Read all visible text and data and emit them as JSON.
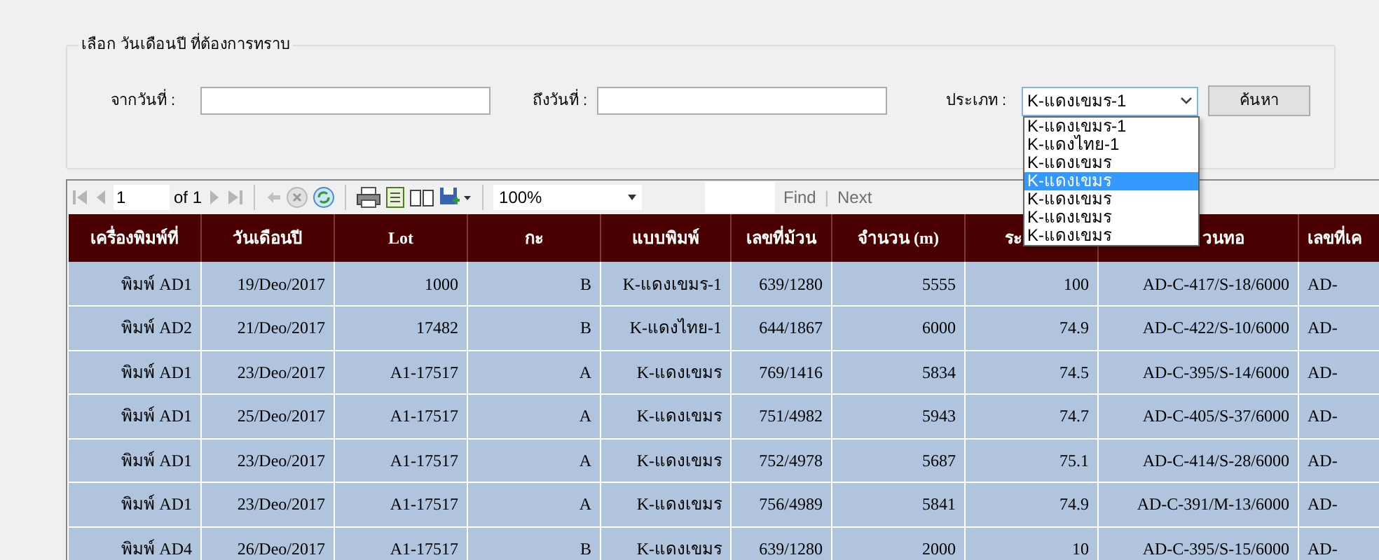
{
  "filter_group": {
    "title": "เลือก วันเดือนปี ที่ต้องการทราบ",
    "from_label": "จากวันที่ :",
    "to_label": "ถึงวันที่ :",
    "type_label": "ประเภท :",
    "type_value": "K-แดงเขมร-1",
    "expanded": true,
    "search_button": "ค้นหา",
    "options": [
      {
        "label": "K-แดงเขมร-1",
        "selected": false
      },
      {
        "label": "K-แดงไทย-1",
        "selected": false
      },
      {
        "label": "K-แดงเขมร",
        "selected": false
      },
      {
        "label": "K-แดงเขมร",
        "selected": true
      },
      {
        "label": "K-แดงเขมร",
        "selected": false
      },
      {
        "label": "K-แดงเขมร",
        "selected": false
      },
      {
        "label": "K-แดงเขมร",
        "selected": false
      }
    ]
  },
  "toolbar": {
    "page": "1",
    "of_pages": "of 1",
    "zoom": "100%",
    "find": "Find",
    "separator": "|",
    "next": "Next"
  },
  "table": {
    "columns": [
      {
        "label": "เครื่องพิมพ์ที่"
      },
      {
        "label": "วันเดือนปี"
      },
      {
        "label": "Lot"
      },
      {
        "label": "กะ"
      },
      {
        "label": "แบบพิมพ์"
      },
      {
        "label": "เลขที่ม้วน"
      },
      {
        "label": "จำนวน (m)"
      },
      {
        "label": "ระ"
      },
      {
        "label": "วนทอ"
      },
      {
        "label": "เลขที่เค"
      }
    ],
    "rows": [
      [
        "พิมพ์ AD1",
        "19/Deo/2017",
        "1000",
        "B",
        "K-แดงเขมร-1",
        "639/1280",
        "5555",
        "100",
        "AD-C-417/S-18/6000",
        "AD-"
      ],
      [
        "พิมพ์ AD2",
        "21/Deo/2017",
        "17482",
        "B",
        "K-แดงไทย-1",
        "644/1867",
        "6000",
        "74.9",
        "AD-C-422/S-10/6000",
        "AD-"
      ],
      [
        "พิมพ์ AD1",
        "23/Deo/2017",
        "A1-17517",
        "A",
        "K-แดงเขมร",
        "769/1416",
        "5834",
        "74.5",
        "AD-C-395/S-14/6000",
        "AD-"
      ],
      [
        "พิมพ์ AD1",
        "25/Deo/2017",
        "A1-17517",
        "A",
        "K-แดงเขมร",
        "751/4982",
        "5943",
        "74.7",
        "AD-C-405/S-37/6000",
        "AD-"
      ],
      [
        "พิมพ์ AD1",
        "23/Deo/2017",
        "A1-17517",
        "A",
        "K-แดงเขมร",
        "752/4978",
        "5687",
        "75.1",
        "AD-C-414/S-28/6000",
        "AD-"
      ],
      [
        "พิมพ์ AD1",
        "23/Deo/2017",
        "A1-17517",
        "A",
        "K-แดงเขมร",
        "756/4989",
        "5841",
        "74.9",
        "AD-C-391/M-13/6000",
        "AD-"
      ],
      [
        "พิมพ์ AD4",
        "26/Deo/2017",
        "A1-17517",
        "B",
        "K-แดงเขมร",
        "639/1280",
        "2000",
        "10",
        "AD-C-395/S-15/6000",
        "AD-"
      ]
    ]
  }
}
